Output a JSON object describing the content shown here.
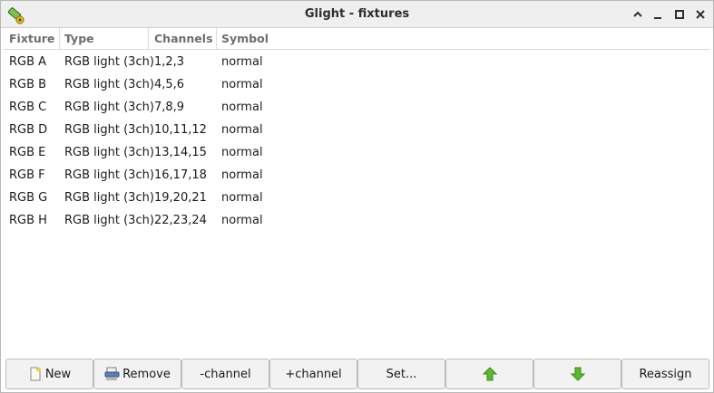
{
  "window": {
    "title": "Glight - fixtures",
    "buttons": [
      "minimize",
      "maximize",
      "close"
    ]
  },
  "table": {
    "columns": [
      "Fixture",
      "Type",
      "Channels",
      "Symbol"
    ],
    "rows": [
      [
        "RGB A",
        "RGB light (3ch)",
        "1,2,3",
        "normal"
      ],
      [
        "RGB B",
        "RGB light (3ch)",
        "4,5,6",
        "normal"
      ],
      [
        "RGB C",
        "RGB light (3ch)",
        "7,8,9",
        "normal"
      ],
      [
        "RGB D",
        "RGB light (3ch)",
        "10,11,12",
        "normal"
      ],
      [
        "RGB E",
        "RGB light (3ch)",
        "13,14,15",
        "normal"
      ],
      [
        "RGB F",
        "RGB light (3ch)",
        "16,17,18",
        "normal"
      ],
      [
        "RGB G",
        "RGB light (3ch)",
        "19,20,21",
        "normal"
      ],
      [
        "RGB H",
        "RGB light (3ch)",
        "22,23,24",
        "normal"
      ]
    ]
  },
  "toolbar": {
    "new_label": "New",
    "remove_label": "Remove",
    "minus_channel_label": "-channel",
    "plus_channel_label": "+channel",
    "set_label": "Set...",
    "up_icon": "arrow-up-icon",
    "down_icon": "arrow-down-icon",
    "reassign_label": "Reassign"
  },
  "colors": {
    "arrow_green": "#5cb82f",
    "arrow_green_dark": "#3b8a1a"
  }
}
